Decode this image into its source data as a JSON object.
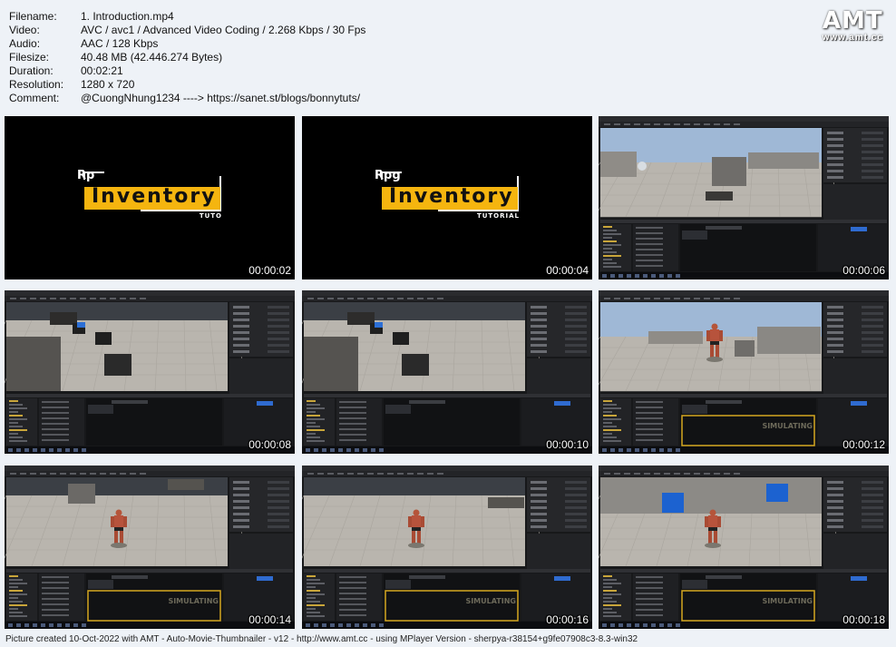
{
  "info": [
    {
      "label": "Filename:",
      "value": "1. Introduction.mp4"
    },
    {
      "label": "Video:",
      "value": "AVC / avc1 / Advanced Video Coding / 2.268 Kbps / 30 Fps"
    },
    {
      "label": "Audio:",
      "value": "AAC / 128 Kbps"
    },
    {
      "label": "Filesize:",
      "value": "40.48 MB (42.446.274 Bytes)"
    },
    {
      "label": "Duration:",
      "value": "00:02:21"
    },
    {
      "label": "Resolution:",
      "value": "1280 x 720"
    },
    {
      "label": "Comment:",
      "value": "@CuongNhung1234 ----> https://sanet.st/blogs/bonnytuts/"
    }
  ],
  "logo": {
    "big": "AMT",
    "small": "www.amt.cc"
  },
  "thumbnails": [
    {
      "time": "00:00:02",
      "kind": "title",
      "title_top": "Rp",
      "title_main": "Inventory",
      "title_bottom": "TUTO"
    },
    {
      "time": "00:00:04",
      "kind": "title",
      "title_top": "Rpg",
      "title_main": "Inventory",
      "title_bottom": "TUTORIAL"
    },
    {
      "time": "00:00:06",
      "kind": "editor-sky",
      "overlay": ""
    },
    {
      "time": "00:00:08",
      "kind": "editor-cubes",
      "overlay": ""
    },
    {
      "time": "00:00:10",
      "kind": "editor-cubes2",
      "overlay": ""
    },
    {
      "time": "00:00:12",
      "kind": "editor-char-sky",
      "overlay": "SIMULATING"
    },
    {
      "time": "00:00:14",
      "kind": "editor-char",
      "overlay": "SIMULATING"
    },
    {
      "time": "00:00:16",
      "kind": "editor-char2",
      "overlay": "SIMULATING"
    },
    {
      "time": "00:00:18",
      "kind": "editor-char-blue",
      "overlay": "SIMULATING"
    }
  ],
  "footer": "Picture created 10-Oct-2022 with AMT - Auto-Movie-Thumbnailer - v12 - http://www.amt.cc - using MPlayer Version - sherpya-r38154+g9fe07908c3-8.3-win32",
  "colors": {
    "background": "#eef2f7",
    "title_yellow": "#f5b50f",
    "editor_dark": "#1e1f22",
    "sim_yellow": "#d6a820"
  }
}
